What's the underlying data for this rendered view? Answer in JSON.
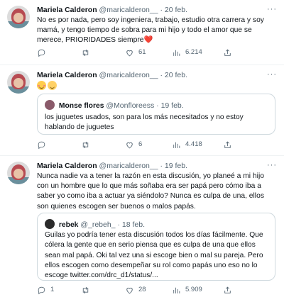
{
  "tweets": [
    {
      "name": "Mariela Calderon",
      "handle": "@maricalderon__",
      "date": "20 feb.",
      "text": "No es por nada, pero soy ingeniera, trabajo, estudio otra carrera y soy mamá, y tengo tiempo de sobra para mi hijo y todo el amor que se merece, PRIORIDADES siempre",
      "text_emoji": "❤️",
      "replies": "",
      "retweets": "",
      "likes": "61",
      "views": "6.214"
    },
    {
      "name": "Mariela Calderon",
      "handle": "@maricalderon__",
      "date": "20 feb.",
      "text": "",
      "quote": {
        "name": "Monse flores",
        "handle": "@Monfloreess",
        "date": "19 feb.",
        "text": "los juguetes usados, son para los más necesitados y no estoy hablando de juguetes"
      },
      "replies": "",
      "retweets": "",
      "likes": "6",
      "views": "4.418"
    },
    {
      "name": "Mariela Calderon",
      "handle": "@maricalderon__",
      "date": "19 feb.",
      "text": "Nunca nadie va a tener la razón en esta discusión, yo planeé a mi hijo con un hombre que lo que más soñaba era ser papá pero cómo iba a saber yo como iba a actuar ya siéndolo? Nunca es culpa de una, ellos son quienes escogen ser buenos o malos papás.",
      "quote": {
        "name": "rebek",
        "handle": "@_rebeh_",
        "date": "18 feb.",
        "text": "Guilas yo podría tener esta discusión todos los días fácilmente. Que cólera la gente que en serio piensa que es culpa de una que ellos sean mal papá. Oki tal vez una si escoge bien o mal su pareja. Pero ellos escogen como desempeñar su rol como papás uno eso no lo escoge twitter.com/drc_d1/status/..."
      },
      "replies": "1",
      "retweets": "",
      "likes": "28",
      "views": "5.909"
    }
  ],
  "ui": {
    "separator": "·",
    "more": "···"
  },
  "colors": {
    "text": "#0f1419",
    "muted": "#536471",
    "border": "#cfd9de",
    "heart": "#e0245e"
  },
  "icons": [
    "reply-icon",
    "retweet-icon",
    "like-icon",
    "views-icon",
    "share-icon",
    "more-icon"
  ]
}
